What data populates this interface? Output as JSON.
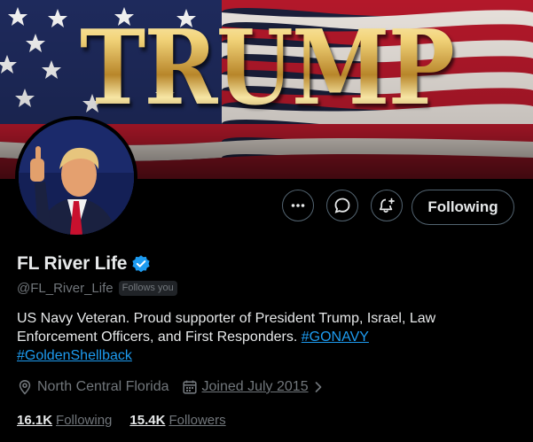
{
  "banner": {
    "text": "TRUMP"
  },
  "profile": {
    "display_name": "FL River Life",
    "handle": "@FL_River_Life",
    "follows_you": "Follows you",
    "bio_text": "US Navy Veteran.  Proud supporter of President Trump, Israel, Law Enforcement Officers, and First Responders. ",
    "bio_tags": [
      "#GONAVY",
      "#GoldenShellback"
    ],
    "location": "North Central Florida",
    "joined": "Joined July 2015",
    "verified": true
  },
  "actions": {
    "follow_label": "Following",
    "more_icon": "more-icon",
    "message_icon": "message-icon",
    "notify_icon": "notification-bell-icon"
  },
  "stats": {
    "following_count": "16.1K",
    "following_label": "Following",
    "followers_count": "15.4K",
    "followers_label": "Followers"
  },
  "colors": {
    "background": "#000000",
    "text_primary": "#e7e9ea",
    "text_secondary": "#71767b",
    "link": "#1d9bf0",
    "border": "#536471",
    "verified_badge": "#1d9bf0"
  }
}
